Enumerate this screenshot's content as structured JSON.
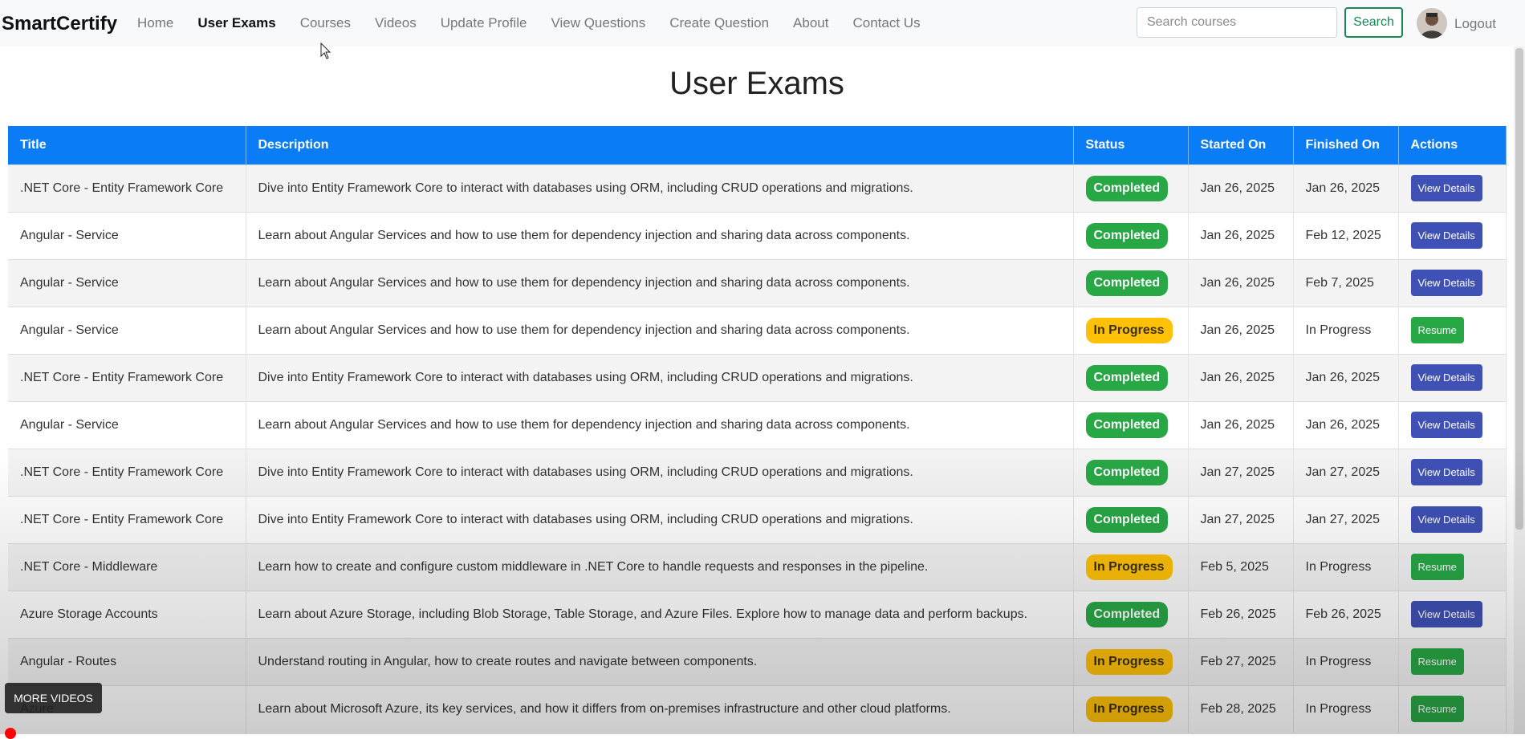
{
  "navbar": {
    "brand": "SmartCertify",
    "links": [
      {
        "label": "Home",
        "active": false
      },
      {
        "label": "User Exams",
        "active": true
      },
      {
        "label": "Courses",
        "active": false
      },
      {
        "label": "Videos",
        "active": false
      },
      {
        "label": "Update Profile",
        "active": false
      },
      {
        "label": "View Questions",
        "active": false
      },
      {
        "label": "Create Question",
        "active": false
      },
      {
        "label": "About",
        "active": false
      },
      {
        "label": "Contact Us",
        "active": false
      }
    ],
    "search_placeholder": "Search courses",
    "search_label": "Search",
    "logout_label": "Logout"
  },
  "page_title": "User Exams",
  "table": {
    "headers": [
      "Title",
      "Description",
      "Status",
      "Started On",
      "Finished On",
      "Actions"
    ],
    "rows": [
      {
        "title": ".NET Core - Entity Framework Core",
        "description": "Dive into Entity Framework Core to interact with databases using ORM, including CRUD operations and migrations.",
        "status": "Completed",
        "started": "Jan 26, 2025",
        "finished": "Jan 26, 2025",
        "action": "View Details"
      },
      {
        "title": "Angular - Service",
        "description": "Learn about Angular Services and how to use them for dependency injection and sharing data across components.",
        "status": "Completed",
        "started": "Jan 26, 2025",
        "finished": "Feb 12, 2025",
        "action": "View Details"
      },
      {
        "title": "Angular - Service",
        "description": "Learn about Angular Services and how to use them for dependency injection and sharing data across components.",
        "status": "Completed",
        "started": "Jan 26, 2025",
        "finished": "Feb 7, 2025",
        "action": "View Details"
      },
      {
        "title": "Angular - Service",
        "description": "Learn about Angular Services and how to use them for dependency injection and sharing data across components.",
        "status": "In Progress",
        "started": "Jan 26, 2025",
        "finished": "In Progress",
        "action": "Resume"
      },
      {
        "title": ".NET Core - Entity Framework Core",
        "description": "Dive into Entity Framework Core to interact with databases using ORM, including CRUD operations and migrations.",
        "status": "Completed",
        "started": "Jan 26, 2025",
        "finished": "Jan 26, 2025",
        "action": "View Details"
      },
      {
        "title": "Angular - Service",
        "description": "Learn about Angular Services and how to use them for dependency injection and sharing data across components.",
        "status": "Completed",
        "started": "Jan 26, 2025",
        "finished": "Jan 26, 2025",
        "action": "View Details"
      },
      {
        "title": ".NET Core - Entity Framework Core",
        "description": "Dive into Entity Framework Core to interact with databases using ORM, including CRUD operations and migrations.",
        "status": "Completed",
        "started": "Jan 27, 2025",
        "finished": "Jan 27, 2025",
        "action": "View Details"
      },
      {
        "title": ".NET Core - Entity Framework Core",
        "description": "Dive into Entity Framework Core to interact with databases using ORM, including CRUD operations and migrations.",
        "status": "Completed",
        "started": "Jan 27, 2025",
        "finished": "Jan 27, 2025",
        "action": "View Details"
      },
      {
        "title": ".NET Core - Middleware",
        "description": "Learn how to create and configure custom middleware in .NET Core to handle requests and responses in the pipeline.",
        "status": "In Progress",
        "started": "Feb 5, 2025",
        "finished": "In Progress",
        "action": "Resume"
      },
      {
        "title": "Azure Storage Accounts",
        "description": "Learn about Azure Storage, including Blob Storage, Table Storage, and Azure Files. Explore how to manage data and perform backups.",
        "status": "Completed",
        "started": "Feb 26, 2025",
        "finished": "Feb 26, 2025",
        "action": "View Details"
      },
      {
        "title": "Angular - Routes",
        "description": "Understand routing in Angular, how to create routes and navigate between components.",
        "status": "In Progress",
        "started": "Feb 27, 2025",
        "finished": "In Progress",
        "action": "Resume"
      },
      {
        "title": "Azure",
        "description": "Learn about Microsoft Azure, its key services, and how it differs from on-premises infrastructure and other cloud platforms.",
        "status": "In Progress",
        "started": "Feb 28, 2025",
        "finished": "In Progress",
        "action": "Resume"
      }
    ]
  },
  "overlay": {
    "more_videos_label": "MORE VIDEOS"
  },
  "colors": {
    "header_blue": "#0a7df6",
    "completed_green": "#28a745",
    "in_progress_yellow": "#ffc107",
    "view_details_indigo": "#3f51b5",
    "search_outline_green": "#198754"
  },
  "icons": {
    "cursor": "mouse-pointer-icon",
    "avatar": "user-avatar"
  }
}
